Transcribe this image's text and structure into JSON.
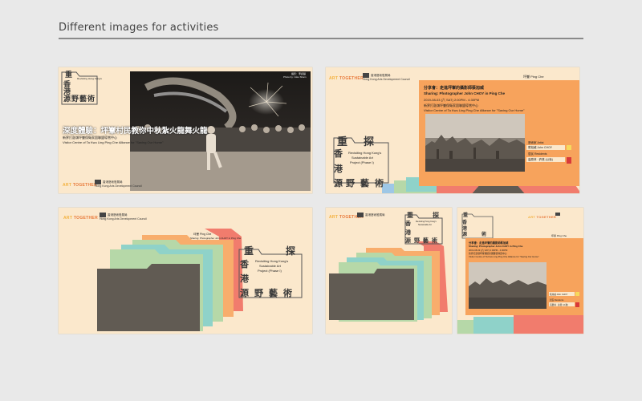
{
  "heading": "Different images for activities",
  "brand": {
    "logo_a": "ART",
    "logo_b": "TOGETHER",
    "org_line1": "香港藝術發展局",
    "org_line2": "Hong Kong Arts Development Council"
  },
  "folder_title": {
    "c1": "重",
    "c2": "探",
    "c3": "香",
    "c4": "港",
    "c5": "源",
    "c6": "野",
    "c7": "藝",
    "c8": "術",
    "en1": "Revisiting Hong Kong's",
    "en2": "Sustainable Art",
    "en3": "Project (Phase I)"
  },
  "card1": {
    "credit1": "攝影：李詩韻",
    "credit2": "Photo by: Joko Sham",
    "title": "深度體驗：坪輋村民教你中秋紮火龍舞火龍",
    "venue_zh": "新界打鼓嶺坪輋保衛家園聯盟導賞中心",
    "venue_en": "Visitor Centre of Ta Kwu Ling Ping Che Alliance for \"Saving Our Home\""
  },
  "card2": {
    "tag": "坪輋 Ping Che",
    "title_zh": "分享會：走進坪輋的攝影師蔡旭威",
    "title_en": "Sharing: Photographer John CHOY in Ping Che",
    "date": "2019-08-03 (六 SAT)  2:00PM - 4:30PM",
    "venue_zh": "新界打鼓嶺坪輋保衛家園聯盟導賞中心",
    "venue_en": "Visitor Centre of Ta Kwu Ling Ping Che Alliance for \"Saving Our Home\"",
    "role1": "藝術家 Artist",
    "person1": "蔡旭威 John CHOY",
    "role2": "居民 Residents",
    "person2": "高慶林 · 許慧 (以後)"
  },
  "colors": {
    "bg": "#e9e9e9",
    "card": "#fbe8cc",
    "folder_dark": "#615b53",
    "tab_green": "#b6d8a8",
    "tab_teal": "#8fd2c9",
    "tab_orange": "#f8ad6c",
    "tab_salmon": "#f17c6d",
    "tab_blue": "#9ec7e6",
    "panel_orange": "#f7a35c",
    "accent_red": "#d83a3a",
    "accent_yellow": "#f6d95c"
  }
}
